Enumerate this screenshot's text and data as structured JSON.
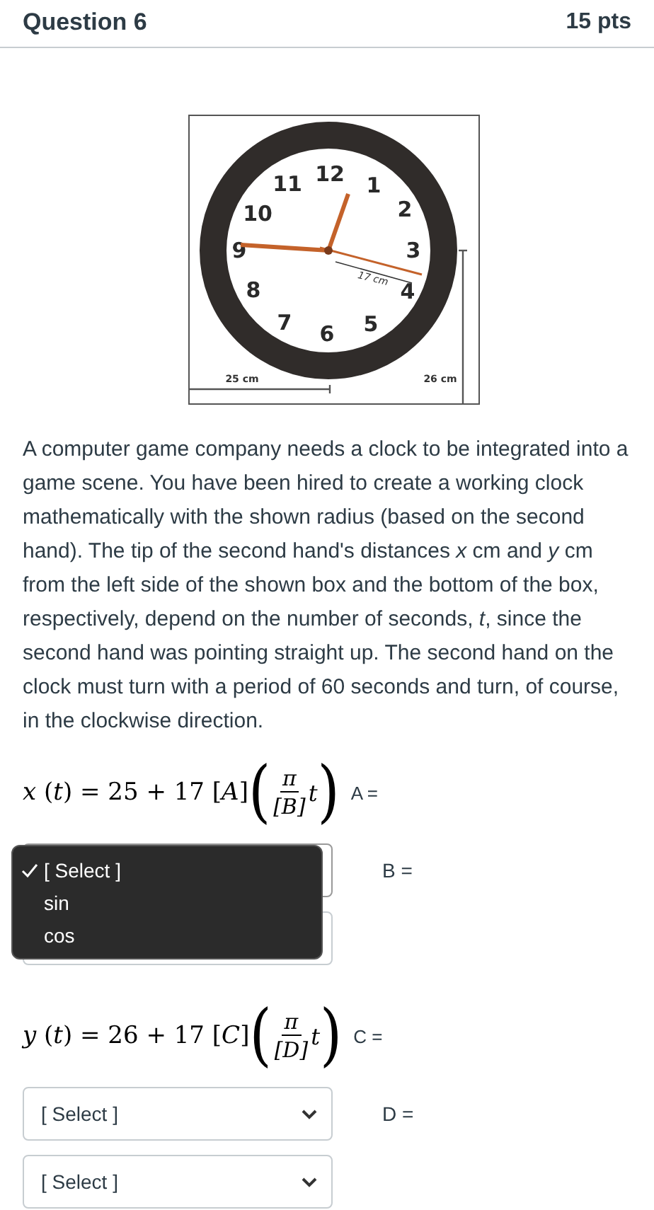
{
  "header": {
    "title": "Question 6",
    "points": "15 pts"
  },
  "figure": {
    "numerals": [
      "12",
      "1",
      "2",
      "3",
      "4",
      "5",
      "6",
      "7",
      "8",
      "9",
      "10",
      "11"
    ],
    "radius_label": "17 cm",
    "width_label": "25 cm",
    "height_label": "26 cm"
  },
  "paragraph": "A computer game company needs a clock to be integrated into a game scene. You have been hired to create a working clock mathematically with the shown radius (based on the second hand). The tip of the second hand's distances *x* cm and *y* cm from the left side of the shown box and the bottom of the box, respectively, depend on the number of seconds, *t*, since the second hand was pointing straight up. The second hand on the clock must turn with a period of 60 seconds and turn, of course, in the clockwise direction.",
  "equations": [
    {
      "prefix": "*x* (*t*) = 25 + 17 [*A*]",
      "open": "(",
      "numerator": "π",
      "denominator": "[*B*]",
      "variable": "t",
      "close": ")",
      "label": "A =",
      "selects": [
        {
          "open": true,
          "label": "B =",
          "options": [
            {
              "text": "[ Select ]",
              "selected": true
            },
            {
              "text": "sin",
              "selected": false
            },
            {
              "text": "cos",
              "selected": false
            }
          ]
        },
        {
          "open": false
        }
      ]
    },
    {
      "prefix": "*y* (*t*) = 26 + 17 [*C*]",
      "open": "(",
      "numerator": "π",
      "denominator": "[*D*]",
      "variable": "t",
      "close": ")",
      "label": "C =",
      "selects": [
        {
          "open": false,
          "value": "[ Select ]",
          "label": "D ="
        },
        {
          "open": false,
          "value": "[ Select ]"
        }
      ]
    }
  ]
}
